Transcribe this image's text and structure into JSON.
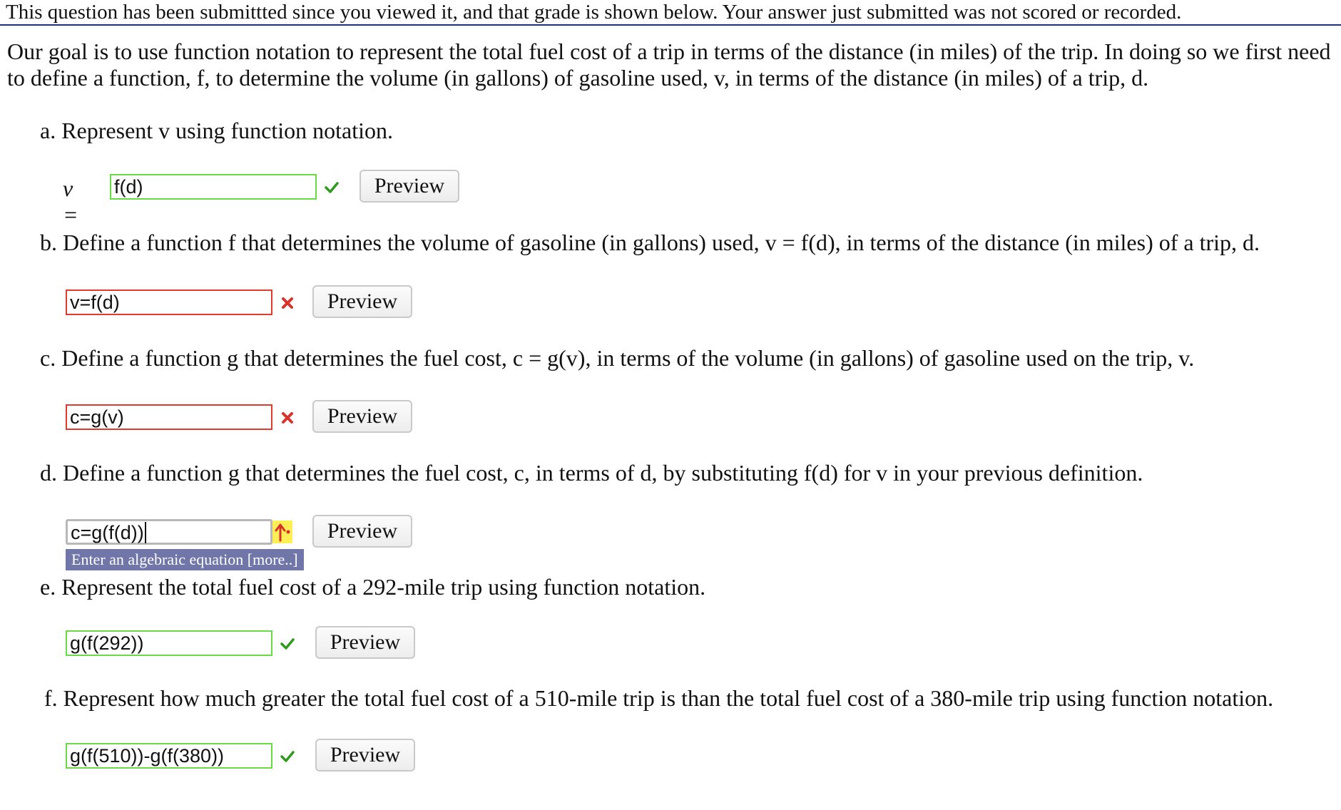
{
  "banner": "This question has been submittted since you viewed it, and that grade is shown below. Your answer just submitted was not scored or recorded.",
  "intro": "Our goal is to use function notation to represent the total fuel cost of a trip in terms of the distance (in miles) of the trip. In doing so we first need to define a function, f, to determine the volume (in gallons) of gasoline used, v, in terms of the distance (in miles) of a trip, d.",
  "parts": {
    "a": {
      "question": "a. Represent v using function notation.",
      "prefix": "v =",
      "answer": "f(d)",
      "status": "correct",
      "preview": "Preview"
    },
    "b": {
      "question": "b. Define a function f that determines the volume of gasoline (in gallons) used, v = f(d), in terms of the distance (in miles) of a trip, d.",
      "answer": "v=f(d)",
      "status": "incorrect",
      "preview": "Preview"
    },
    "c": {
      "question": "c. Define a function g that determines the fuel cost, c = g(v), in terms of the volume (in gallons) of gasoline used on the trip, v.",
      "answer": "c=g(v)",
      "status": "incorrect",
      "preview": "Preview"
    },
    "d": {
      "question": "d. Define a function g that determines the fuel cost, c, in terms of d, by substituting f(d) for v in your previous definition.",
      "answer": "c=g(f(d))",
      "status": "editing",
      "preview": "Preview",
      "hint": "Enter an algebraic equation",
      "hint_more": "[more..]"
    },
    "e": {
      "question": "e. Represent the total fuel cost of a 292-mile trip using function notation.",
      "answer": "g(f(292))",
      "status": "correct",
      "preview": "Preview"
    },
    "f": {
      "question": "f. Represent how much greater the total fuel cost of a 510-mile trip is than the total fuel cost of a 380-mile trip using function notation.",
      "answer": "g(f(510))-g(f(380))",
      "status": "correct",
      "preview": "Preview"
    }
  },
  "colors": {
    "correct": "#66dd44",
    "incorrect": "#e23b2e",
    "hint_bg": "#7076a8",
    "banner_rule": "#1f2f7a"
  },
  "icons": {
    "correct": "checkmark-icon",
    "incorrect": "x-mark-icon",
    "editing": "answer-hint-icon"
  }
}
